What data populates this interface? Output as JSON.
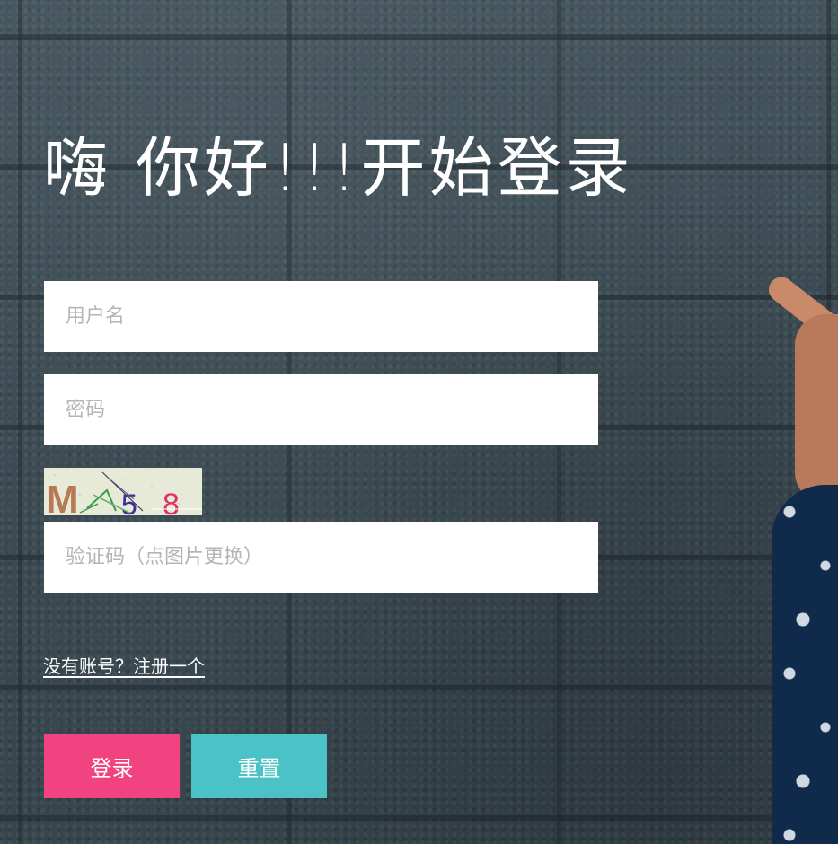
{
  "login": {
    "title": "嗨 你好!!!开始登录",
    "username_placeholder": "用户名",
    "password_placeholder": "密码",
    "captcha_placeholder": "验证码（点图片更换）",
    "captcha_image_text": "M 5 8",
    "register_link": "没有账号？注册一个",
    "login_button": "登录",
    "reset_button": "重置"
  },
  "colors": {
    "login_button": "#f0437f",
    "reset_button": "#4bc2c5",
    "background": "#3f4f57",
    "field_background": "#ffffff"
  }
}
